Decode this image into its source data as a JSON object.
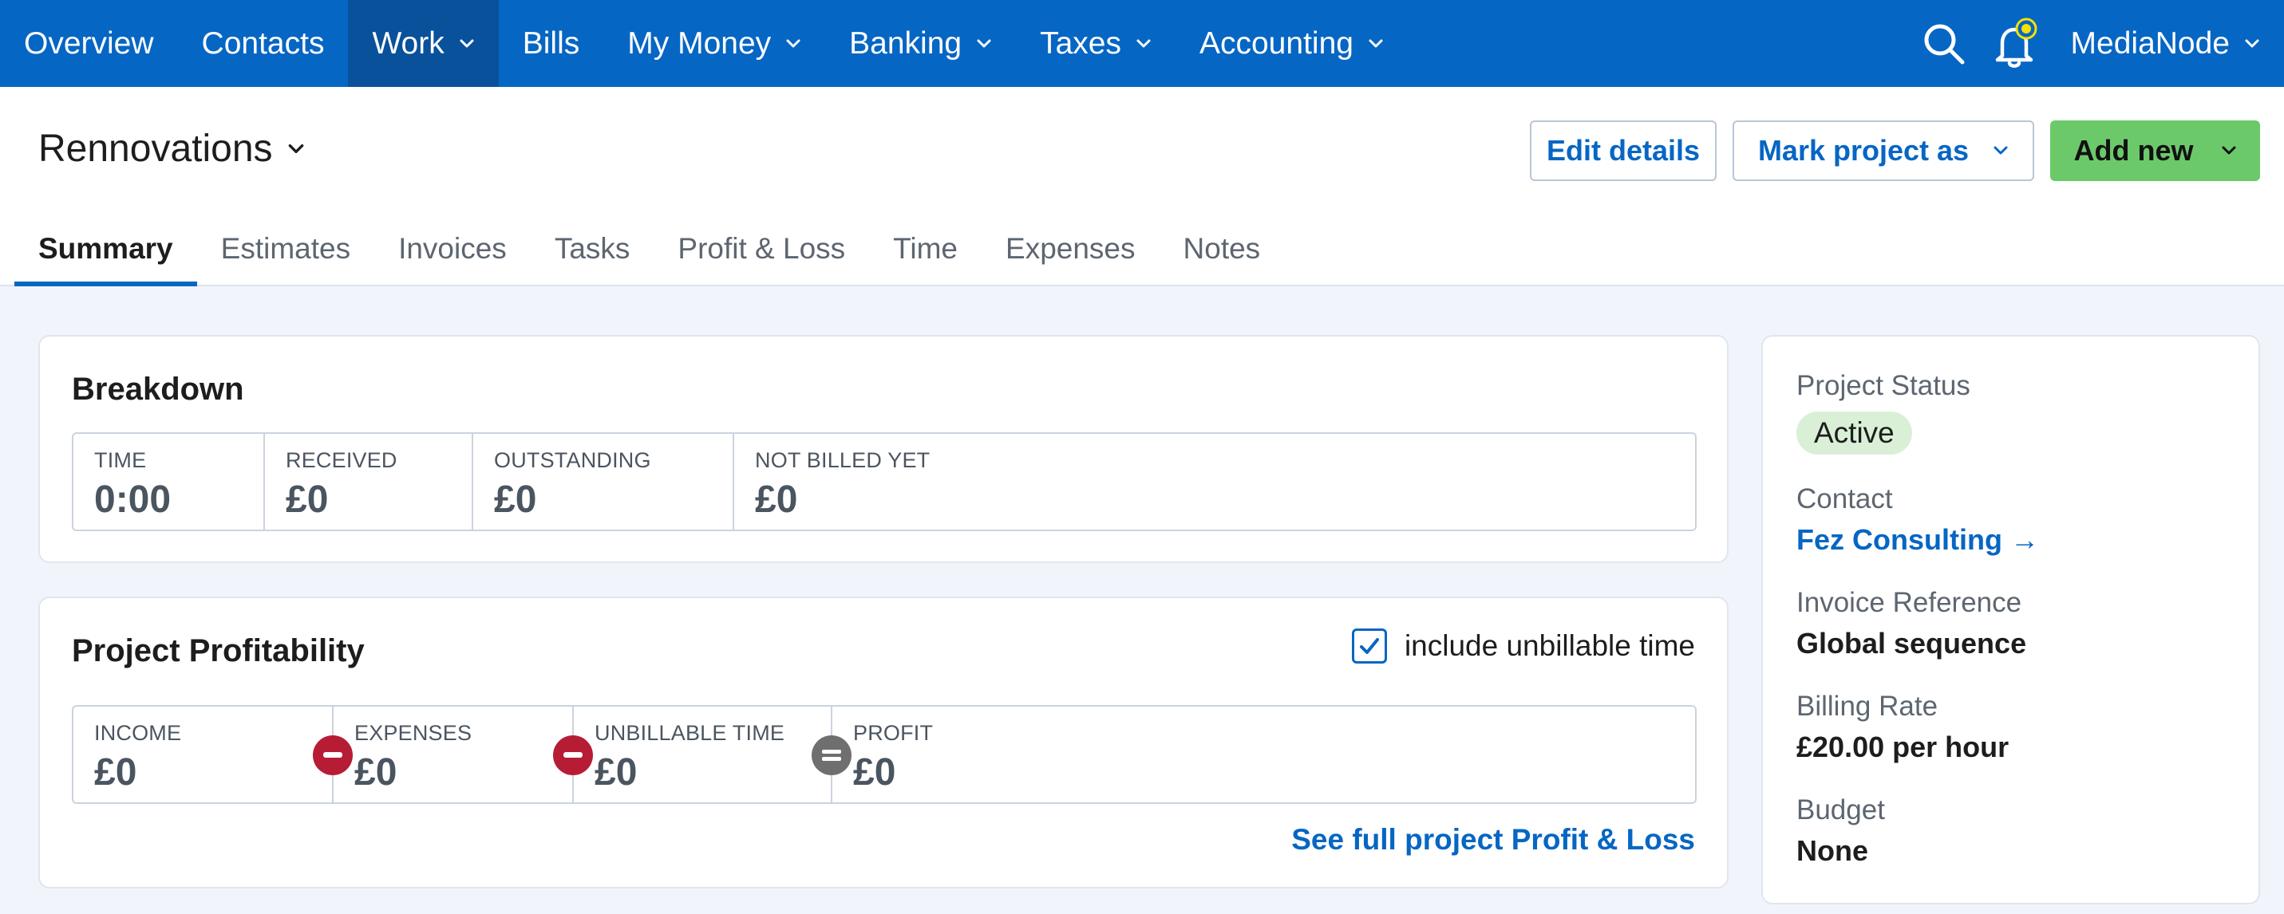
{
  "nav": {
    "items": [
      {
        "label": "Overview",
        "dropdown": false
      },
      {
        "label": "Contacts",
        "dropdown": false
      },
      {
        "label": "Work",
        "dropdown": true,
        "active": true
      },
      {
        "label": "Bills",
        "dropdown": false
      },
      {
        "label": "My Money",
        "dropdown": true
      },
      {
        "label": "Banking",
        "dropdown": true
      },
      {
        "label": "Taxes",
        "dropdown": true
      },
      {
        "label": "Accounting",
        "dropdown": true
      }
    ],
    "account": "MediaNode",
    "icons": [
      "search-icon",
      "notification-bell-icon"
    ]
  },
  "header": {
    "project_title": "Rennovations",
    "edit_label": "Edit details",
    "mark_label": "Mark project as",
    "add_label": "Add new"
  },
  "tabs": [
    {
      "label": "Summary",
      "active": true
    },
    {
      "label": "Estimates"
    },
    {
      "label": "Invoices"
    },
    {
      "label": "Tasks"
    },
    {
      "label": "Profit & Loss"
    },
    {
      "label": "Time"
    },
    {
      "label": "Expenses"
    },
    {
      "label": "Notes"
    }
  ],
  "breakdown": {
    "title": "Breakdown",
    "stats": [
      {
        "label": "TIME",
        "value": "0:00"
      },
      {
        "label": "RECEIVED",
        "value": "£0"
      },
      {
        "label": "OUTSTANDING",
        "value": "£0"
      },
      {
        "label": "NOT BILLED YET",
        "value": "£0"
      }
    ]
  },
  "profitability": {
    "title": "Project Profitability",
    "checkbox_label": "include unbillable time",
    "checkbox_checked": true,
    "stats": [
      {
        "label": "INCOME",
        "value": "£0"
      },
      {
        "label": "EXPENSES",
        "value": "£0"
      },
      {
        "label": "UNBILLABLE TIME",
        "value": "£0"
      },
      {
        "label": "PROFIT",
        "value": "£0"
      }
    ],
    "link": "See full project Profit & Loss"
  },
  "side": {
    "status_label": "Project Status",
    "status_value": "Active",
    "contact_label": "Contact",
    "contact_value": "Fez Consulting →",
    "invoice_ref_label": "Invoice Reference",
    "invoice_ref_value": "Global sequence",
    "billing_rate_label": "Billing Rate",
    "billing_rate_value": "£20.00 per hour",
    "budget_label": "Budget",
    "budget_value": "None"
  },
  "colors": {
    "nav_bg": "#0666c4",
    "nav_active": "#0a519c",
    "primary_link": "#0666c4",
    "add_button": "#6cc96a",
    "minus_op": "#b71c35",
    "equals_op": "#6f6f6f",
    "active_badge": "#d9f0d6",
    "notification_dot": "#f5e100"
  }
}
